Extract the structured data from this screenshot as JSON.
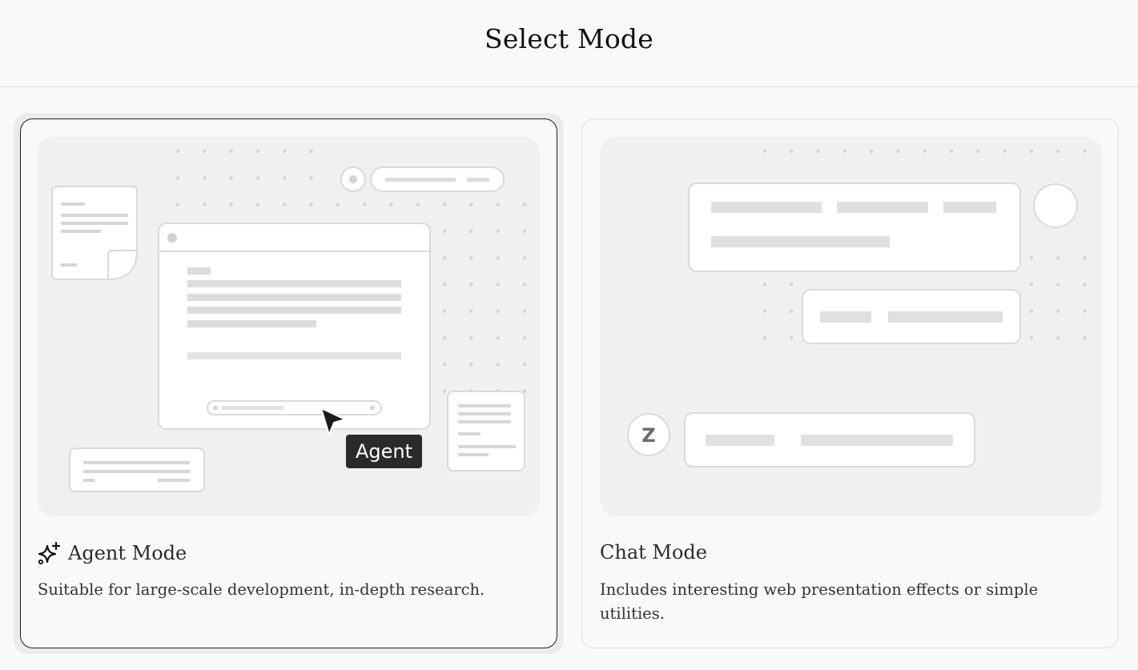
{
  "header": {
    "title": "Select Mode"
  },
  "modes": [
    {
      "name": "Agent Mode",
      "description": "Suitable for large-scale development, in-depth research.",
      "icon": "sparkle-icon",
      "selected": true,
      "illustration": {
        "cursor_label": "Agent"
      }
    },
    {
      "name": "Chat Mode",
      "description": "Includes interesting web presentation effects or simple utilities.",
      "selected": false,
      "illustration": {
        "avatar_letter": "Z"
      }
    }
  ],
  "colors": {
    "background": "#f9f9f9",
    "illustration_bg": "#f0f0f1",
    "selected_border": "#1f1f1f",
    "card_border": "#dedede",
    "tooltip_bg": "#2a2a2a"
  }
}
